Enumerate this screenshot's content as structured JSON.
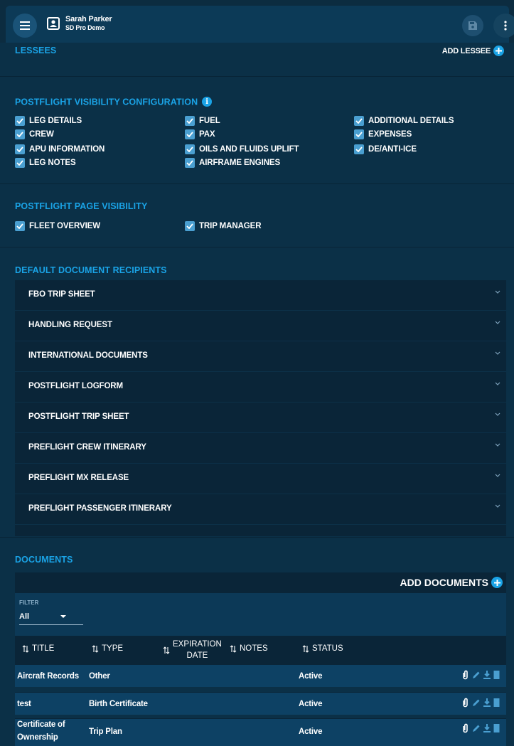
{
  "header": {
    "user_name": "Sarah Parker",
    "org_name": "SD Pro Demo",
    "menu_icon": "menu-icon",
    "save_icon": "save-icon",
    "more_icon": "more-vert-icon"
  },
  "lessees": {
    "title": "LESSEES",
    "add_label": "ADD LESSEE"
  },
  "postflight_visibility": {
    "title": "POSTFLIGHT VISIBILITY CONFIGURATION",
    "options": [
      {
        "label": "LEG DETAILS",
        "checked": true
      },
      {
        "label": "CREW",
        "checked": true
      },
      {
        "label": "APU INFORMATION",
        "checked": true
      },
      {
        "label": "LEG NOTES",
        "checked": true
      },
      {
        "label": "FUEL",
        "checked": true
      },
      {
        "label": "PAX",
        "checked": true
      },
      {
        "label": "OILS AND FLUIDS UPLIFT",
        "checked": true
      },
      {
        "label": "AIRFRAME ENGINES",
        "checked": true
      },
      {
        "label": "ADDITIONAL DETAILS",
        "checked": true
      },
      {
        "label": "EXPENSES",
        "checked": true
      },
      {
        "label": "DE/ANTI-ICE",
        "checked": true
      }
    ]
  },
  "page_visibility": {
    "title": "POSTFLIGHT PAGE VISIBILITY",
    "options": [
      {
        "label": "FLEET OVERVIEW",
        "checked": true
      },
      {
        "label": "TRIP MANAGER",
        "checked": true
      }
    ]
  },
  "recipients": {
    "title": "DEFAULT DOCUMENT RECIPIENTS",
    "items": [
      "FBO TRIP SHEET",
      "HANDLING REQUEST",
      "INTERNATIONAL DOCUMENTS",
      "POSTFLIGHT LOGFORM",
      "POSTFLIGHT TRIP SHEET",
      "PREFLIGHT CREW ITINERARY",
      "PREFLIGHT MX RELEASE",
      "PREFLIGHT PASSENGER ITINERARY"
    ]
  },
  "documents": {
    "title": "DOCUMENTS",
    "add_label": "ADD DOCUMENTS",
    "filter_label": "FILTER",
    "filter_value": "All",
    "columns": {
      "title": "TITLE",
      "type": "TYPE",
      "expiration_line1": "EXPIRATION",
      "expiration_line2": "DATE",
      "notes": "NOTES",
      "status": "STATUS"
    },
    "rows": [
      {
        "title": "Aircraft Records",
        "title_line2": "",
        "type": "Other",
        "status": "Active"
      },
      {
        "title": "test",
        "title_line2": "",
        "type": "Birth Certificate",
        "status": "Active"
      },
      {
        "title": "Certificate of",
        "title_line2": "Ownership",
        "type": "Trip Plan",
        "status": "Active"
      }
    ],
    "accent_color": "#1aa3e6",
    "checkbox_color": "#4a9fd1"
  }
}
